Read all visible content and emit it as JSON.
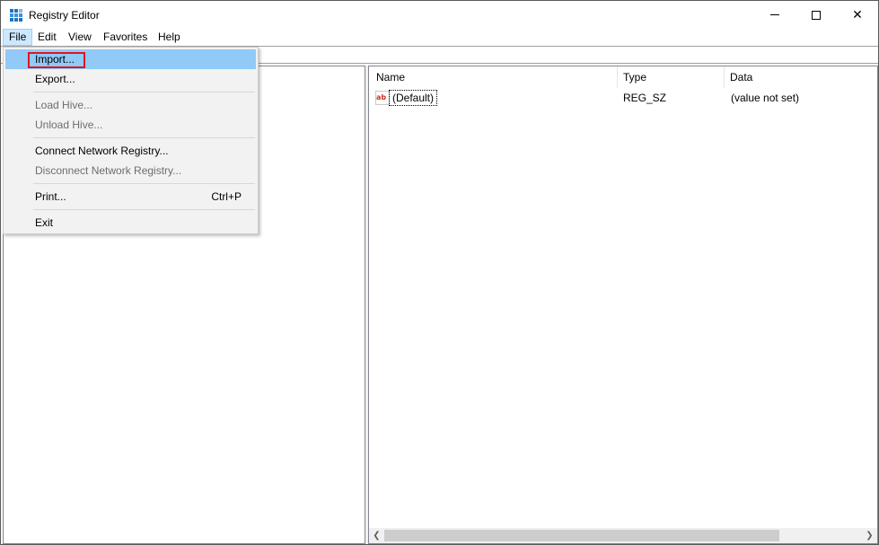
{
  "window": {
    "title": "Registry Editor",
    "controls": {
      "minimize": "minimize",
      "maximize": "maximize",
      "close": "✕"
    }
  },
  "menubar": {
    "items": [
      "File",
      "Edit",
      "View",
      "Favorites",
      "Help"
    ],
    "active": "File"
  },
  "file_menu": {
    "items": [
      {
        "label": "Import...",
        "enabled": true,
        "highlighted": true
      },
      {
        "label": "Export...",
        "enabled": true
      },
      {
        "label": "Load Hive...",
        "enabled": false
      },
      {
        "label": "Unload Hive...",
        "enabled": false
      },
      {
        "label": "Connect Network Registry...",
        "enabled": true
      },
      {
        "label": "Disconnect Network Registry...",
        "enabled": false
      },
      {
        "label": "Print...",
        "enabled": true,
        "shortcut": "Ctrl+P"
      },
      {
        "label": "Exit",
        "enabled": true
      }
    ]
  },
  "list": {
    "columns": [
      "Name",
      "Type",
      "Data"
    ],
    "rows": [
      {
        "icon": "ab",
        "name": "(Default)",
        "type": "REG_SZ",
        "data": "(value not set)"
      }
    ]
  },
  "scrollbar": {
    "left_arrow": "❮",
    "right_arrow": "❯"
  },
  "colors": {
    "menu_hover": "#91c9f7",
    "highlight_outline": "#e0151c",
    "menubar_active": "#cce8ff"
  }
}
